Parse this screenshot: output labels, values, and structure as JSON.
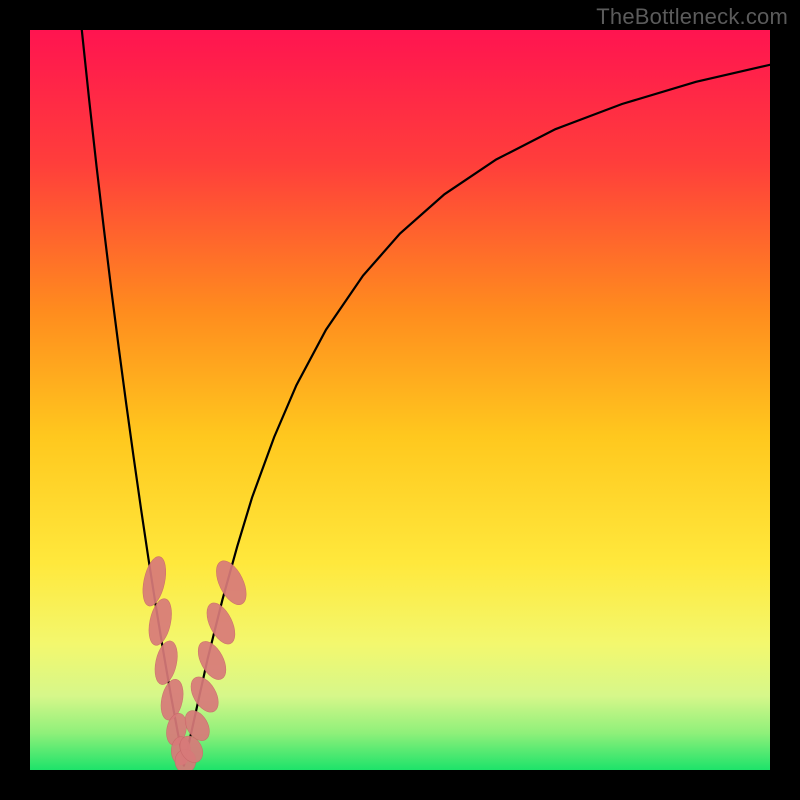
{
  "watermark": "TheBottleneck.com",
  "colors": {
    "frame": "#000000",
    "curve": "#000000",
    "markers_fill": "#d87a7a",
    "markers_stroke": "#c96a6a",
    "gradient_stops": [
      {
        "offset": 0.0,
        "color": "#ff1450"
      },
      {
        "offset": 0.18,
        "color": "#ff3e3b"
      },
      {
        "offset": 0.38,
        "color": "#ff8c1e"
      },
      {
        "offset": 0.55,
        "color": "#ffc81e"
      },
      {
        "offset": 0.72,
        "color": "#ffe83c"
      },
      {
        "offset": 0.83,
        "color": "#f3f86e"
      },
      {
        "offset": 0.9,
        "color": "#d6f78a"
      },
      {
        "offset": 0.95,
        "color": "#8ff07a"
      },
      {
        "offset": 1.0,
        "color": "#1de36a"
      }
    ]
  },
  "chart_data": {
    "type": "line",
    "title": "",
    "xlabel": "",
    "ylabel": "",
    "xlim": [
      0,
      100
    ],
    "ylim": [
      0,
      100
    ],
    "series": [
      {
        "name": "left-branch",
        "x": [
          7,
          8,
          9,
          10,
          11,
          12,
          13,
          14,
          15,
          16,
          17,
          18,
          19,
          20,
          20.8
        ],
        "values": [
          100,
          90.5,
          81.5,
          73.0,
          64.8,
          57.0,
          49.5,
          42.3,
          35.3,
          28.6,
          22.2,
          16.1,
          10.3,
          4.9,
          0.6
        ]
      },
      {
        "name": "right-branch",
        "x": [
          20.8,
          22,
          24,
          26,
          28,
          30,
          33,
          36,
          40,
          45,
          50,
          56,
          63,
          71,
          80,
          90,
          100
        ],
        "values": [
          0.6,
          6.0,
          15.0,
          23.0,
          30.2,
          36.8,
          45.0,
          52.0,
          59.5,
          66.8,
          72.5,
          77.8,
          82.5,
          86.6,
          90.0,
          93.0,
          95.3
        ]
      }
    ],
    "markers": [
      {
        "x": 16.8,
        "y": 25.5,
        "rx": 1.4,
        "ry": 3.4,
        "rot": 12
      },
      {
        "x": 17.6,
        "y": 20.0,
        "rx": 1.4,
        "ry": 3.2,
        "rot": 12
      },
      {
        "x": 18.4,
        "y": 14.5,
        "rx": 1.4,
        "ry": 3.0,
        "rot": 12
      },
      {
        "x": 19.2,
        "y": 9.5,
        "rx": 1.4,
        "ry": 2.8,
        "rot": 12
      },
      {
        "x": 19.8,
        "y": 5.5,
        "rx": 1.3,
        "ry": 2.2,
        "rot": 12
      },
      {
        "x": 20.4,
        "y": 2.6,
        "rx": 1.3,
        "ry": 1.9,
        "rot": 0
      },
      {
        "x": 21.0,
        "y": 1.2,
        "rx": 1.4,
        "ry": 1.6,
        "rot": 0
      },
      {
        "x": 21.8,
        "y": 2.8,
        "rx": 1.4,
        "ry": 1.9,
        "rot": -30
      },
      {
        "x": 22.6,
        "y": 6.0,
        "rx": 1.4,
        "ry": 2.2,
        "rot": -30
      },
      {
        "x": 23.6,
        "y": 10.2,
        "rx": 1.5,
        "ry": 2.6,
        "rot": -30
      },
      {
        "x": 24.6,
        "y": 14.8,
        "rx": 1.5,
        "ry": 2.8,
        "rot": -28
      },
      {
        "x": 25.8,
        "y": 19.8,
        "rx": 1.5,
        "ry": 3.0,
        "rot": -26
      },
      {
        "x": 27.2,
        "y": 25.3,
        "rx": 1.6,
        "ry": 3.2,
        "rot": -26
      }
    ]
  }
}
